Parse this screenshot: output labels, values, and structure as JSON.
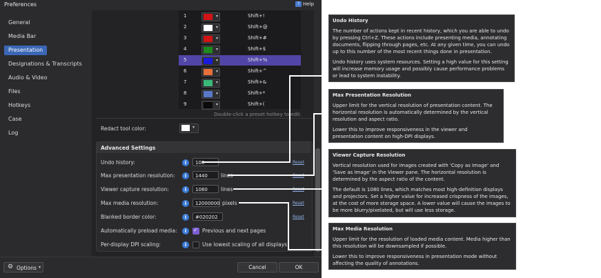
{
  "window": {
    "title": "Preferences",
    "help_label": "Help"
  },
  "sidebar": {
    "items": [
      {
        "label": "General"
      },
      {
        "label": "Media Bar"
      },
      {
        "label": "Presentation"
      },
      {
        "label": "Designations & Transcripts"
      },
      {
        "label": "Audio & Video"
      },
      {
        "label": "Files"
      },
      {
        "label": "Hotkeys"
      },
      {
        "label": "Case"
      },
      {
        "label": "Log"
      }
    ],
    "active": "Presentation"
  },
  "presets": [
    {
      "num": "1",
      "color": "#d21414",
      "hotkey": "Shift+!"
    },
    {
      "num": "2",
      "color": "#ffffff",
      "hotkey": "Shift+@"
    },
    {
      "num": "3",
      "color": "#d21414",
      "hotkey": "Shift+#"
    },
    {
      "num": "4",
      "color": "#1e8a1e",
      "hotkey": "Shift+$"
    },
    {
      "num": "5",
      "color": "#1a1ad8",
      "hotkey": "Shift+%"
    },
    {
      "num": "6",
      "color": "#e8703a",
      "hotkey": "Shift+^"
    },
    {
      "num": "7",
      "color": "#3ab87a",
      "hotkey": "Shift+&"
    },
    {
      "num": "8",
      "color": "#5a78c8",
      "hotkey": "Shift+*"
    },
    {
      "num": "9",
      "color": "#0a0a0a",
      "hotkey": "Shift+("
    }
  ],
  "preset_hint": "Double-click a preset hotkey to edit.",
  "redact": {
    "label": "Redact tool color:",
    "color": "#ffffff"
  },
  "advanced": {
    "title": "Advanced Settings",
    "undo": {
      "label": "Undo history:",
      "value": "100",
      "reset": "Reset"
    },
    "max_res": {
      "label": "Max presentation resolution:",
      "value": "1440",
      "unit": "lines",
      "reset": "Reset"
    },
    "viewer_res": {
      "label": "Viewer capture resolution:",
      "value": "1080",
      "unit": "lines",
      "reset": "Reset"
    },
    "media_res": {
      "label": "Max media resolution:",
      "value": "12000000",
      "unit": "pixels",
      "reset": "Reset"
    },
    "blank": {
      "label": "Blanked border color:",
      "value": "#020202",
      "reset": "Reset"
    },
    "preload": {
      "label": "Automatically preload media:",
      "checked": true,
      "text": "Previous and next pages"
    },
    "dpi": {
      "label": "Per-display DPI scaling:",
      "checked": false,
      "text": "Use lowest scaling of all displays"
    }
  },
  "footer": {
    "options_label": "Options",
    "cancel_label": "Cancel",
    "ok_label": "OK"
  },
  "tooltips": {
    "undo": {
      "title": "Undo History",
      "p1": "The number of actions kept in recent history, which you are able to undo by pressing Ctrl+Z. These actions include presenting media, annotating documents, flipping through pages, etc. At any given time, you can undo up to this number of the most recent things done in presentation.",
      "p2": "Undo history uses system resources. Setting a high value for this setting will increase memory usage and possibly cause performance problems or lead to system instability."
    },
    "max_res": {
      "title": "Max Presentation Resolution",
      "p1": "Upper limit for the vertical resolution of presentation content. The horizontal resolution is automatically determined by the vertical resolution and aspect ratio.",
      "p2": "Lower this to improve responsiveness in the viewer and presentation content on high-DPI displays."
    },
    "viewer": {
      "title": "Viewer Capture Resolution",
      "p1": "Vertical resolution used for images created with 'Copy as Image' and 'Save as Image' in the Viewer pane. The horizontal resolution is determined by the aspect ratio of the content.",
      "p2": "The default is 1080 lines, which matches most high-definition displays and projectors. Set a higher value for increased crispness of the images, at the cost of more storage space. A lower value will cause the images to be more blurry/pixelated, but will use less storage."
    },
    "media": {
      "title": "Max Media Resolution",
      "p1": "Upper limit for the resolution of loaded media content. Media higher than this resolution will be downsampled if possible.",
      "p2": "Lower this to improve responsiveness in presentation mode without affecting the quality of annotations."
    }
  }
}
